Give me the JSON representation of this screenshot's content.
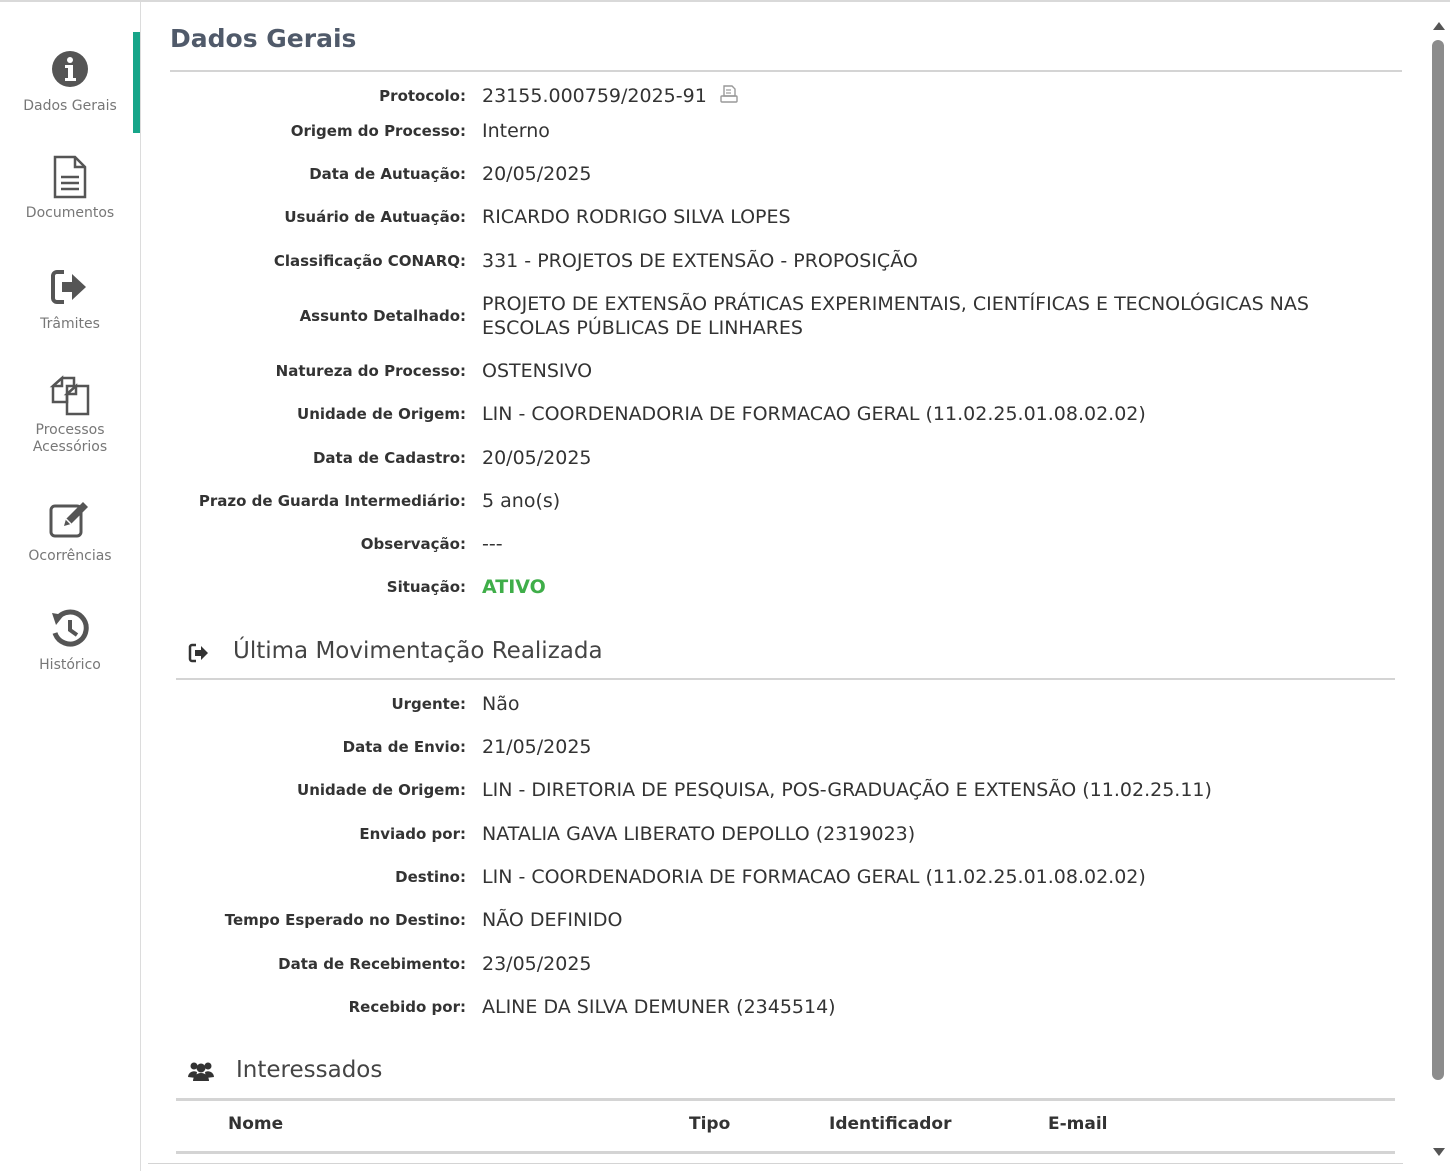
{
  "sidebar": {
    "items": [
      {
        "label": "Dados Gerais",
        "icon": "info-circle-icon",
        "active": true
      },
      {
        "label": "Documentos",
        "icon": "document-icon"
      },
      {
        "label": "Trâmites",
        "icon": "sign-out-arrow-icon"
      },
      {
        "label_line1": "Processos",
        "label_line2": "Acessórios",
        "icon": "copy-files-icon"
      },
      {
        "label": "Ocorrências",
        "icon": "edit-pencil-icon"
      },
      {
        "label": "Histórico",
        "icon": "history-icon"
      }
    ],
    "accent_color": "#17a589"
  },
  "page_title": "Dados Gerais",
  "dados_gerais": [
    {
      "label": "Protocolo:",
      "value": "23155.000759/2025-91"
    },
    {
      "label": "Origem do Processo:",
      "value": "Interno"
    },
    {
      "label": "Data de Autuação:",
      "value": "20/05/2025"
    },
    {
      "label": "Usuário de Autuação:",
      "value": "RICARDO RODRIGO SILVA LOPES"
    },
    {
      "label": "Classificação CONARQ:",
      "value": "331 - PROJETOS DE EXTENSÃO - PROPOSIÇÃO"
    },
    {
      "label": "Assunto Detalhado:",
      "value_line1": "PROJETO DE EXTENSÃO PRÁTICAS EXPERIMENTAIS, CIENTÍFICAS E TECNOLÓGICAS NAS",
      "value_line2": "ESCOLAS PÚBLICAS DE LINHARES"
    },
    {
      "label": "Natureza do Processo:",
      "value": "OSTENSIVO"
    },
    {
      "label": "Unidade de Origem:",
      "value": "LIN - COORDENADORIA DE FORMACAO GERAL (11.02.25.01.08.02.02)"
    },
    {
      "label": "Data de Cadastro:",
      "value": "20/05/2025"
    },
    {
      "label": "Prazo de Guarda Intermediário:",
      "value": "5 ano(s)"
    },
    {
      "label": "Observação:",
      "value": "---"
    },
    {
      "label": "Situação:",
      "value": "ATIVO",
      "color": "#3fae49"
    }
  ],
  "ultima_movimentacao": {
    "title": "Última Movimentação Realizada",
    "rows": [
      {
        "label": "Urgente:",
        "value": "Não"
      },
      {
        "label": "Data de Envio:",
        "value": "21/05/2025"
      },
      {
        "label": "Unidade de Origem:",
        "value": "LIN - DIRETORIA DE PESQUISA, POS-GRADUAÇÃO E EXTENSÃO (11.02.25.11)"
      },
      {
        "label": "Enviado por:",
        "value": "NATALIA GAVA LIBERATO DEPOLLO (2319023)"
      },
      {
        "label": "Destino:",
        "value": "LIN - COORDENADORIA DE FORMACAO GERAL (11.02.25.01.08.02.02)"
      },
      {
        "label": "Tempo Esperado no Destino:",
        "value": "NÃO DEFINIDO"
      },
      {
        "label": "Data de Recebimento:",
        "value": "23/05/2025"
      },
      {
        "label": "Recebido por:",
        "value": "ALINE DA SILVA DEMUNER (2345514)"
      }
    ]
  },
  "interessados": {
    "title": "Interessados",
    "columns": [
      "Nome",
      "Tipo",
      "Identificador",
      "E-mail"
    ]
  }
}
